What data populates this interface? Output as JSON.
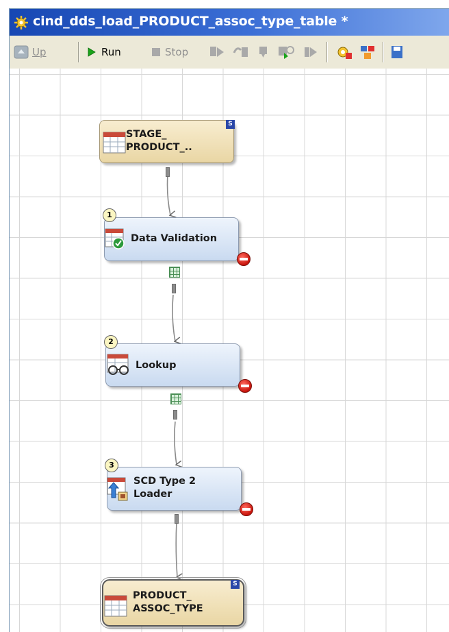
{
  "window": {
    "title": "cind_dds_load_PRODUCT_assoc_type_table *"
  },
  "toolbar": {
    "up_label": "Up",
    "run_label": "Run",
    "stop_label": "Stop",
    "icons": [
      "up-icon",
      "run-icon",
      "stop-icon",
      "step-icon",
      "step-over-icon",
      "pause-icon",
      "continue-icon",
      "skip-icon",
      "job-properties-icon",
      "diagram-icon",
      "save-icon"
    ]
  },
  "nodes": [
    {
      "id": "stage",
      "kind": "source-table",
      "lines": [
        "STAGE_",
        "PRODUCT_.."
      ],
      "badge": "S"
    },
    {
      "id": "validation",
      "kind": "transform",
      "step": "1",
      "lines": [
        "Data Validation"
      ]
    },
    {
      "id": "lookup",
      "kind": "transform",
      "step": "2",
      "lines": [
        "Lookup"
      ]
    },
    {
      "id": "scd",
      "kind": "transform",
      "step": "3",
      "lines": [
        "SCD Type 2",
        "Loader"
      ]
    },
    {
      "id": "target",
      "kind": "target-table",
      "lines": [
        "PRODUCT_",
        "ASSOC_TYPE"
      ],
      "badge": "S"
    }
  ],
  "colors": {
    "title_bar": "#1747b3",
    "table_node": "#efdeb3",
    "transform_node": "#d6e3f4",
    "error": "#d0160d",
    "run_green": "#1aa31a"
  }
}
